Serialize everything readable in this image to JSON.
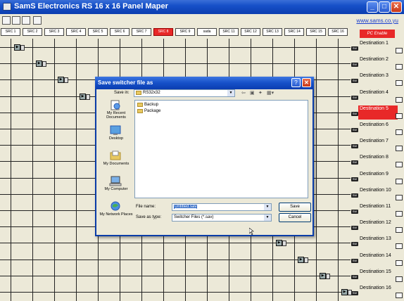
{
  "window": {
    "title": "SamS Electronics RS 16 x 16 Panel Maper"
  },
  "header": {
    "website": "www.sams.co.yu",
    "pc_enable": "PC Enable"
  },
  "sources": [
    "SRC 1",
    "SRC 2",
    "SRC 3",
    "SRC 4",
    "SRC 5",
    "SRC 6",
    "SRC 7",
    "SRC 8",
    "SRC 9",
    "sada",
    "SRC 11",
    "SRC 12",
    "SRC 13",
    "SRC 14",
    "SRC 15",
    "SRC 16"
  ],
  "active_source": 8,
  "destinations": [
    "Destination 1",
    "Destination 2",
    "Destination 3",
    "Destination 4",
    "Destination 5",
    "Destination 6",
    "Destination 7",
    "Destination 8",
    "Destination 9",
    "Destination 10",
    "Destination 11",
    "Destination 12",
    "Destination 13",
    "Destination 14",
    "Destination 15",
    "Destination 16"
  ],
  "active_destination": 5,
  "dialog": {
    "title": "Save switcher file as",
    "save_in_label": "Save in:",
    "save_in_value": "RS32x32",
    "places": [
      "My Recent Documents",
      "Desktop",
      "My Documents",
      "My Computer",
      "My Network Places"
    ],
    "files": [
      "Backup",
      "Package"
    ],
    "file_name_label": "File name:",
    "file_name_value": "Untitled.sav",
    "save_type_label": "Save as type:",
    "save_type_value": "Switcher Files (*.sav)",
    "save_button": "Save",
    "cancel_button": "Cancel"
  },
  "colors": {
    "titlebar": "#1650c8",
    "active": "#e82828",
    "grid_bg": "#ece9d8"
  },
  "icons": [
    "app-icon",
    "new-file-icon",
    "save-icon",
    "open-icon",
    "print-icon",
    "switch-icon",
    "folder-icon",
    "help-icon",
    "close-icon"
  ]
}
